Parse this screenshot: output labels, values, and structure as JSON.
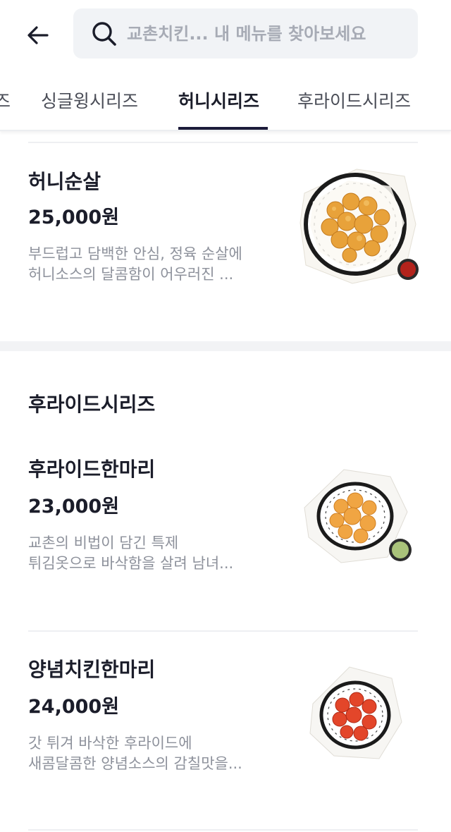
{
  "header": {
    "search_placeholder": "교촌치킨... 내 메뉴를 찾아보세요"
  },
  "tabs": [
    {
      "label": "즈"
    },
    {
      "label": "싱글윙시리즈"
    },
    {
      "label": "허니시리즈"
    },
    {
      "label": "후라이드시리즈"
    }
  ],
  "active_tab": "허니시리즈",
  "sections": [
    {
      "items": [
        {
          "name": "허니순살",
          "price": "25,000원",
          "desc_line1": "부드럽고 담백한 안심, 정육 순살에",
          "desc_line2": "허니소스의 달콤함이 어우러진 ..."
        }
      ]
    },
    {
      "title": "후라이드시리즈",
      "items": [
        {
          "name": "후라이드한마리",
          "price": "23,000원",
          "desc_line1": "교촌의 비법이 담긴 특제",
          "desc_line2": "튀김옷으로 바삭함을 살려 남녀..."
        },
        {
          "name": "양념치킨한마리",
          "price": "24,000원",
          "desc_line1": "갓 튀겨 바삭한 후라이드에",
          "desc_line2": "새콤달콤한 양념소스의 감칠맛을..."
        }
      ]
    }
  ],
  "colors": {
    "accent": "#1c1b3a",
    "honey_chicken": "#e8a23a",
    "fried_chicken": "#f0a543",
    "yangnyeom_chicken": "#e3462a"
  }
}
